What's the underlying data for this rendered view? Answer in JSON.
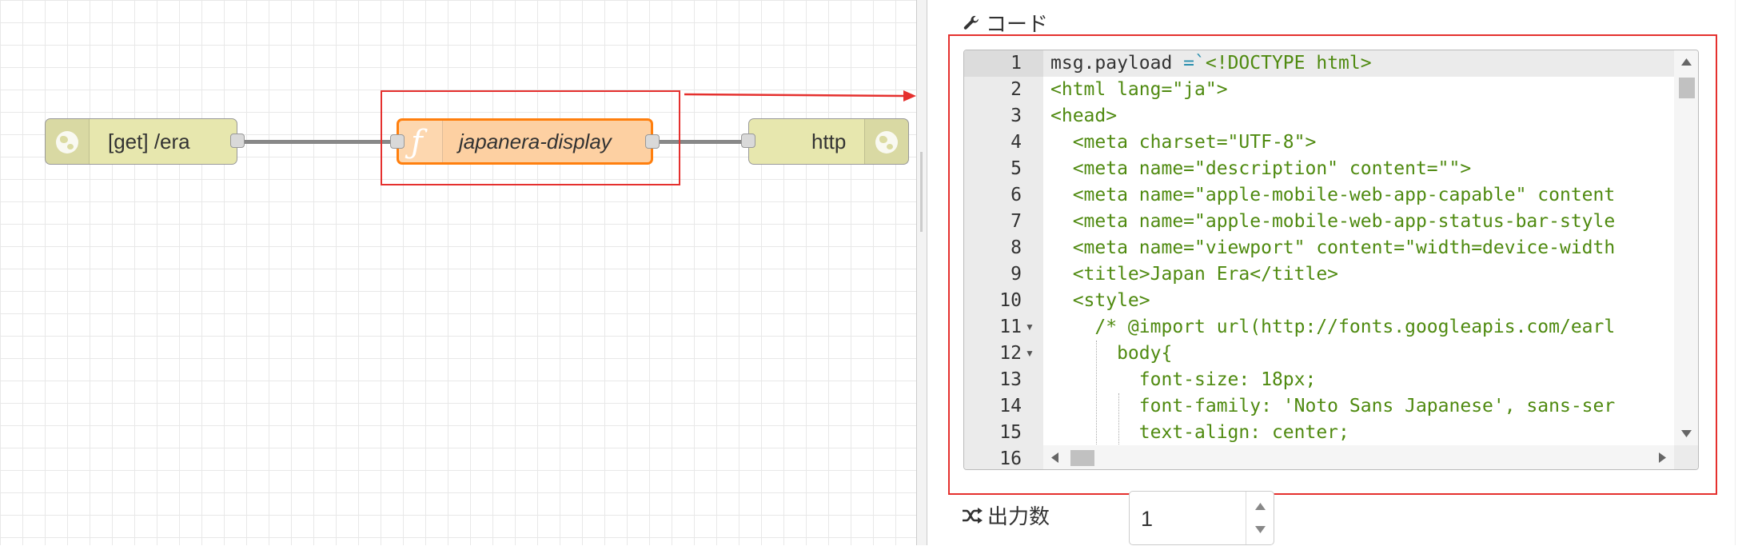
{
  "flow": {
    "nodes": [
      {
        "label": "[get] /era",
        "type": "http in"
      },
      {
        "label": "japanera-display",
        "type": "function"
      },
      {
        "label": "http",
        "type": "http response"
      }
    ]
  },
  "editor": {
    "code_label": "コード",
    "outputs_label": "出力数",
    "outputs_value": "1",
    "line_numbers": [
      "1",
      "2",
      "3",
      "4",
      "5",
      "6",
      "7",
      "8",
      "9",
      "10",
      "11",
      "12",
      "13",
      "14",
      "15",
      "16"
    ],
    "code_lines": [
      "msg.payload =`<!DOCTYPE html>",
      "<html lang=\"ja\">",
      "<head>",
      "  <meta charset=\"UTF-8\">",
      "  <meta name=\"description\" content=\"\">",
      "  <meta name=\"apple-mobile-web-app-capable\" content",
      "  <meta name=\"apple-mobile-web-app-status-bar-style",
      "  <meta name=\"viewport\" content=\"width=device-width",
      "  <title>Japan Era</title>",
      "  <style>",
      "    /* @import url(http://fonts.googleapis.com/earl",
      "      body{",
      "        font-size: 18px;",
      "        font-family: 'Noto Sans Japanese', sans-ser",
      "        text-align: center;"
    ]
  },
  "colors": {
    "inject_node": "#e7e7ae",
    "function_node": "#fdd0a2",
    "function_border": "#ff7f0e",
    "highlight": "#e5302e",
    "code_string": "#4f8a10"
  },
  "icons": {
    "code_label": "wrench-icon",
    "outputs_label": "shuffle-icon",
    "inject": "globe-icon",
    "function": "function-icon"
  }
}
